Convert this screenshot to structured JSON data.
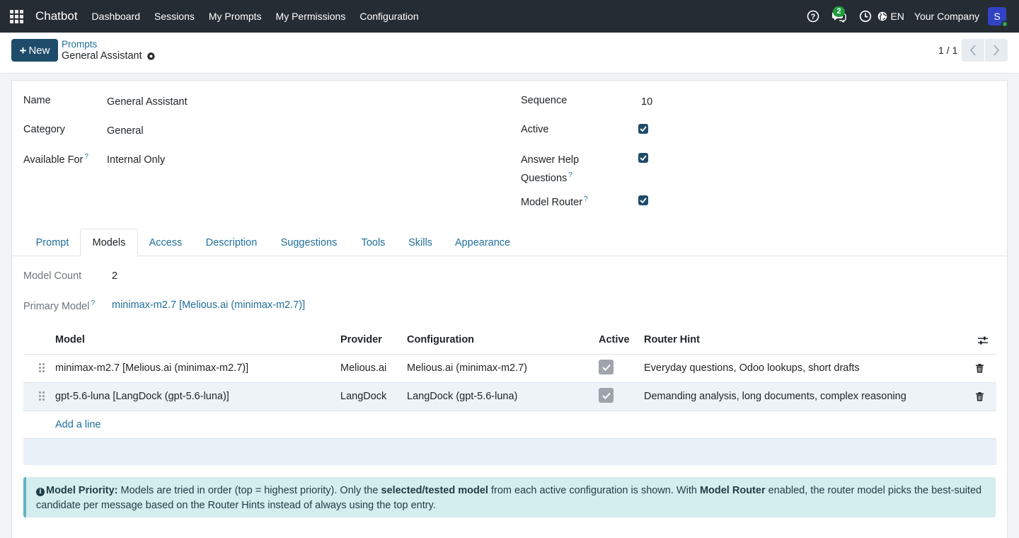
{
  "navbar": {
    "brand": "Chatbot",
    "menu": [
      "Dashboard",
      "Sessions",
      "My Prompts",
      "My Permissions",
      "Configuration"
    ],
    "messages_badge": "2",
    "language": "EN",
    "company": "Your Company",
    "avatar_initial": "S"
  },
  "control_panel": {
    "new_button": "New",
    "breadcrumb": "Prompts",
    "record_title": "General Assistant",
    "pager": "1 / 1"
  },
  "form": {
    "name_label": "Name",
    "name_value": "General Assistant",
    "category_label": "Category",
    "category_value": "General",
    "available_label": "Available For",
    "available_value": "Internal Only",
    "sequence_label": "Sequence",
    "sequence_value": "10",
    "active_label": "Active",
    "active_checked": true,
    "help_questions_label_1": "Answer Help",
    "help_questions_label_2": "Questions",
    "help_questions_checked": true,
    "model_router_label": "Model Router",
    "model_router_checked": true,
    "help_mark": "?"
  },
  "tabs": [
    {
      "label": "Prompt",
      "active": false
    },
    {
      "label": "Models",
      "active": true
    },
    {
      "label": "Access",
      "active": false
    },
    {
      "label": "Description",
      "active": false
    },
    {
      "label": "Suggestions",
      "active": false
    },
    {
      "label": "Tools",
      "active": false
    },
    {
      "label": "Skills",
      "active": false
    },
    {
      "label": "Appearance",
      "active": false
    }
  ],
  "models_tab": {
    "model_count_label": "Model Count",
    "model_count_value": "2",
    "primary_model_label": "Primary Model",
    "primary_model_value": "minimax-m2.7 [Melious.ai (minimax-m2.7)]",
    "columns": [
      "Model",
      "Provider",
      "Configuration",
      "Active",
      "Router Hint"
    ],
    "rows": [
      {
        "model": "minimax-m2.7 [Melious.ai (minimax-m2.7)]",
        "provider": "Melious.ai",
        "configuration": "Melious.ai (minimax-m2.7)",
        "active": true,
        "router_hint": "Everyday questions, Odoo lookups, short drafts"
      },
      {
        "model": "gpt-5.6-luna [LangDock (gpt-5.6-luna)]",
        "provider": "LangDock",
        "configuration": "LangDock (gpt-5.6-luna)",
        "active": true,
        "router_hint": "Demanding analysis, long documents, complex reasoning"
      }
    ],
    "add_line": "Add a line"
  },
  "alert": {
    "title": "Model Priority:",
    "text_1": " Models are tried in order (top = highest priority). Only the ",
    "bold_1": "selected/tested model",
    "text_2": " from each active configuration is shown. With ",
    "bold_2": "Model Router",
    "text_3": " enabled, the router model picks the best-suited candidate per message based on the Router Hints instead of always using the top entry."
  },
  "colors": {
    "navbar_bg": "#262c34",
    "primary": "#1f4c6b",
    "link": "#1f6f9b",
    "alert_bg": "#d4edee",
    "badge": "#1e9d3c"
  }
}
